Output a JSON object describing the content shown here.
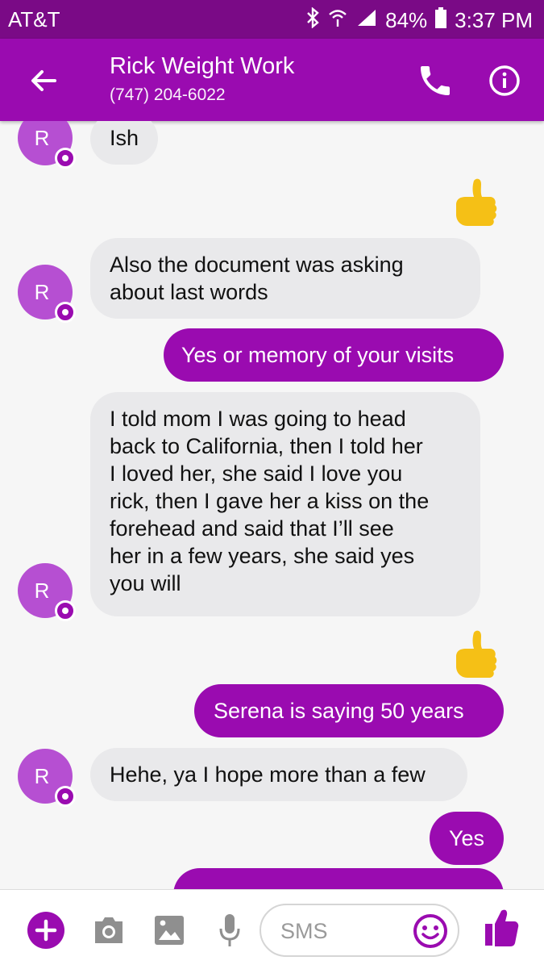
{
  "status": {
    "carrier": "AT&T",
    "battery": "84%",
    "time": "3:37 PM"
  },
  "header": {
    "name": "Rick Weight Work",
    "phone": "(747) 204-6022"
  },
  "avatar_letter": "R",
  "messages": [
    {
      "from": "them",
      "text": "Ish"
    },
    {
      "from": "me",
      "type": "like"
    },
    {
      "from": "them",
      "text": "Also the document was asking\nabout last words"
    },
    {
      "from": "me",
      "text": "Yes or memory of your visits"
    },
    {
      "from": "them",
      "text": "I told mom I was going to head\nback to California, then I told her\nI loved her, she said I love you\nrick, then I gave her a kiss on the\nforehead and said that I’ll see\nher in a few years, she said yes\nyou will"
    },
    {
      "from": "me",
      "type": "like"
    },
    {
      "from": "me",
      "text": "Serena is saying 50 years"
    },
    {
      "from": "them",
      "text": "Hehe, ya I hope more than a few"
    },
    {
      "from": "me",
      "text": "Yes"
    }
  ],
  "composer": {
    "placeholder": "SMS"
  },
  "colors": {
    "accent": "#9a0bb0",
    "statusbar": "#7a0a86",
    "incoming": "#e9e9eb",
    "thumb": "#f5c016"
  },
  "icons": [
    "back-arrow-icon",
    "phone-icon",
    "info-icon",
    "plus-icon",
    "camera-icon",
    "gallery-icon",
    "mic-icon",
    "emoji-icon",
    "like-icon"
  ]
}
